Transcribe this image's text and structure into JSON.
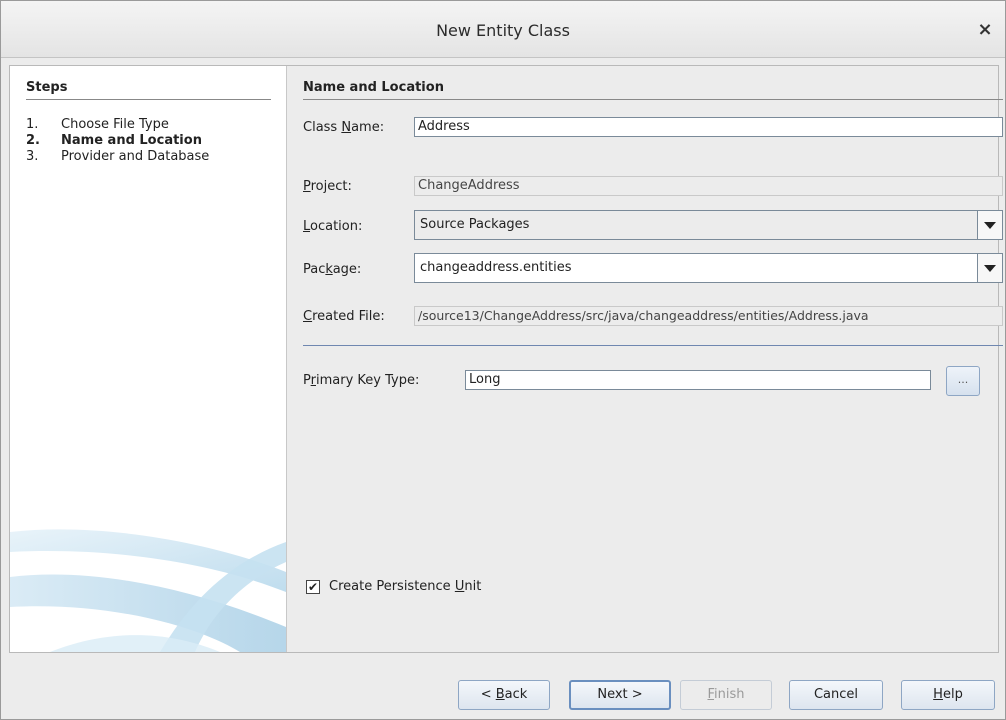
{
  "window": {
    "title": "New Entity Class"
  },
  "steps": {
    "title": "Steps",
    "items": [
      {
        "num": "1.",
        "label": "Choose File Type"
      },
      {
        "num": "2.",
        "label": "Name and Location"
      },
      {
        "num": "3.",
        "label": "Provider and Database"
      }
    ]
  },
  "form": {
    "section_title": "Name and Location",
    "class_name_label": "Class Name:",
    "class_name_value": "Address",
    "project_label": "Project:",
    "project_value": "ChangeAddress",
    "location_label": "Location:",
    "location_value": "Source Packages",
    "package_label": "Package:",
    "package_value": "changeaddress.entities",
    "created_file_label": "Created File:",
    "created_file_value": "/source13/ChangeAddress/src/java/changeaddress/entities/Address.java",
    "primary_key_label": "Primary Key Type:",
    "primary_key_value": "Long",
    "browse_label": "...",
    "persistence_label": "Create Persistence Unit",
    "persistence_checked": true
  },
  "buttons": {
    "back": "< Back",
    "next": "Next >",
    "finish": "Finish",
    "cancel": "Cancel",
    "help": "Help"
  },
  "icons": {
    "close": "close-icon",
    "dropdown": "chevron-down-icon",
    "checkbox": "checkmark-icon"
  },
  "colors": {
    "accent": "#6a8fbf",
    "separator": "#6f87b0",
    "swoosh": "#a9cfe6"
  }
}
